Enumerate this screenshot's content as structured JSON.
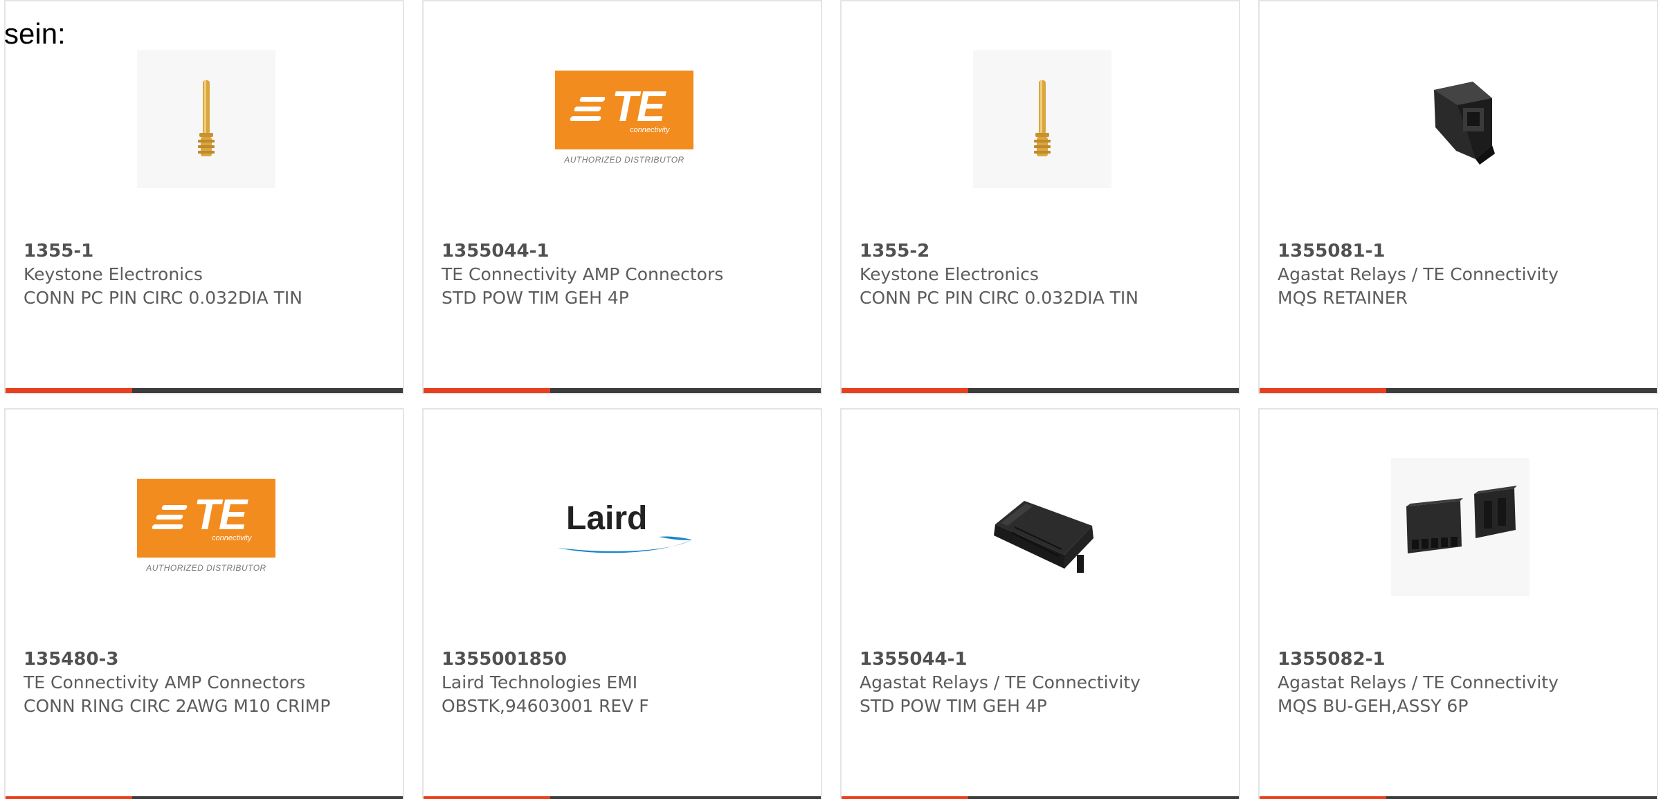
{
  "intro_text": "sein:",
  "colors": {
    "accent": "#e8401c",
    "bar": "#3c3c3c",
    "te_orange": "#f28c1f",
    "laird_blue": "#1a86c8"
  },
  "products": [
    {
      "part_number": "1355-1",
      "manufacturer": "Keystone Electronics",
      "description": "CONN PC PIN CIRC 0.032DIA TIN",
      "image": "gold-pin-image"
    },
    {
      "part_number": "1355044-1",
      "manufacturer": "TE Connectivity AMP Connectors",
      "description": "STD POW TIM GEH 4P",
      "image": "te-logo",
      "logo_text": "TE",
      "logo_subtext": "connectivity",
      "logo_caption": "AUTHORIZED DISTRIBUTOR"
    },
    {
      "part_number": "1355-2",
      "manufacturer": "Keystone Electronics",
      "description": "CONN PC PIN CIRC 0.032DIA TIN",
      "image": "gold-pin-image"
    },
    {
      "part_number": "1355081-1",
      "manufacturer": "Agastat Relays / TE Connectivity",
      "description": "MQS RETAINER",
      "image": "black-retainer-image"
    },
    {
      "part_number": "135480-3",
      "manufacturer": "TE Connectivity AMP Connectors",
      "description": "CONN RING CIRC 2AWG M10 CRIMP",
      "image": "te-logo",
      "logo_text": "TE",
      "logo_subtext": "connectivity",
      "logo_caption": "AUTHORIZED DISTRIBUTOR"
    },
    {
      "part_number": "1355001850",
      "manufacturer": "Laird Technologies EMI",
      "description": "OBSTK,94603001 REV F",
      "image": "laird-logo",
      "logo_text": "Laird"
    },
    {
      "part_number": "1355044-1",
      "manufacturer": "Agastat Relays / TE Connectivity",
      "description": "STD POW TIM GEH 4P",
      "image": "black-housing-image"
    },
    {
      "part_number": "1355082-1",
      "manufacturer": "Agastat Relays / TE Connectivity",
      "description": "MQS BU-GEH,ASSY 6P",
      "image": "black-connector-pair-image"
    }
  ]
}
